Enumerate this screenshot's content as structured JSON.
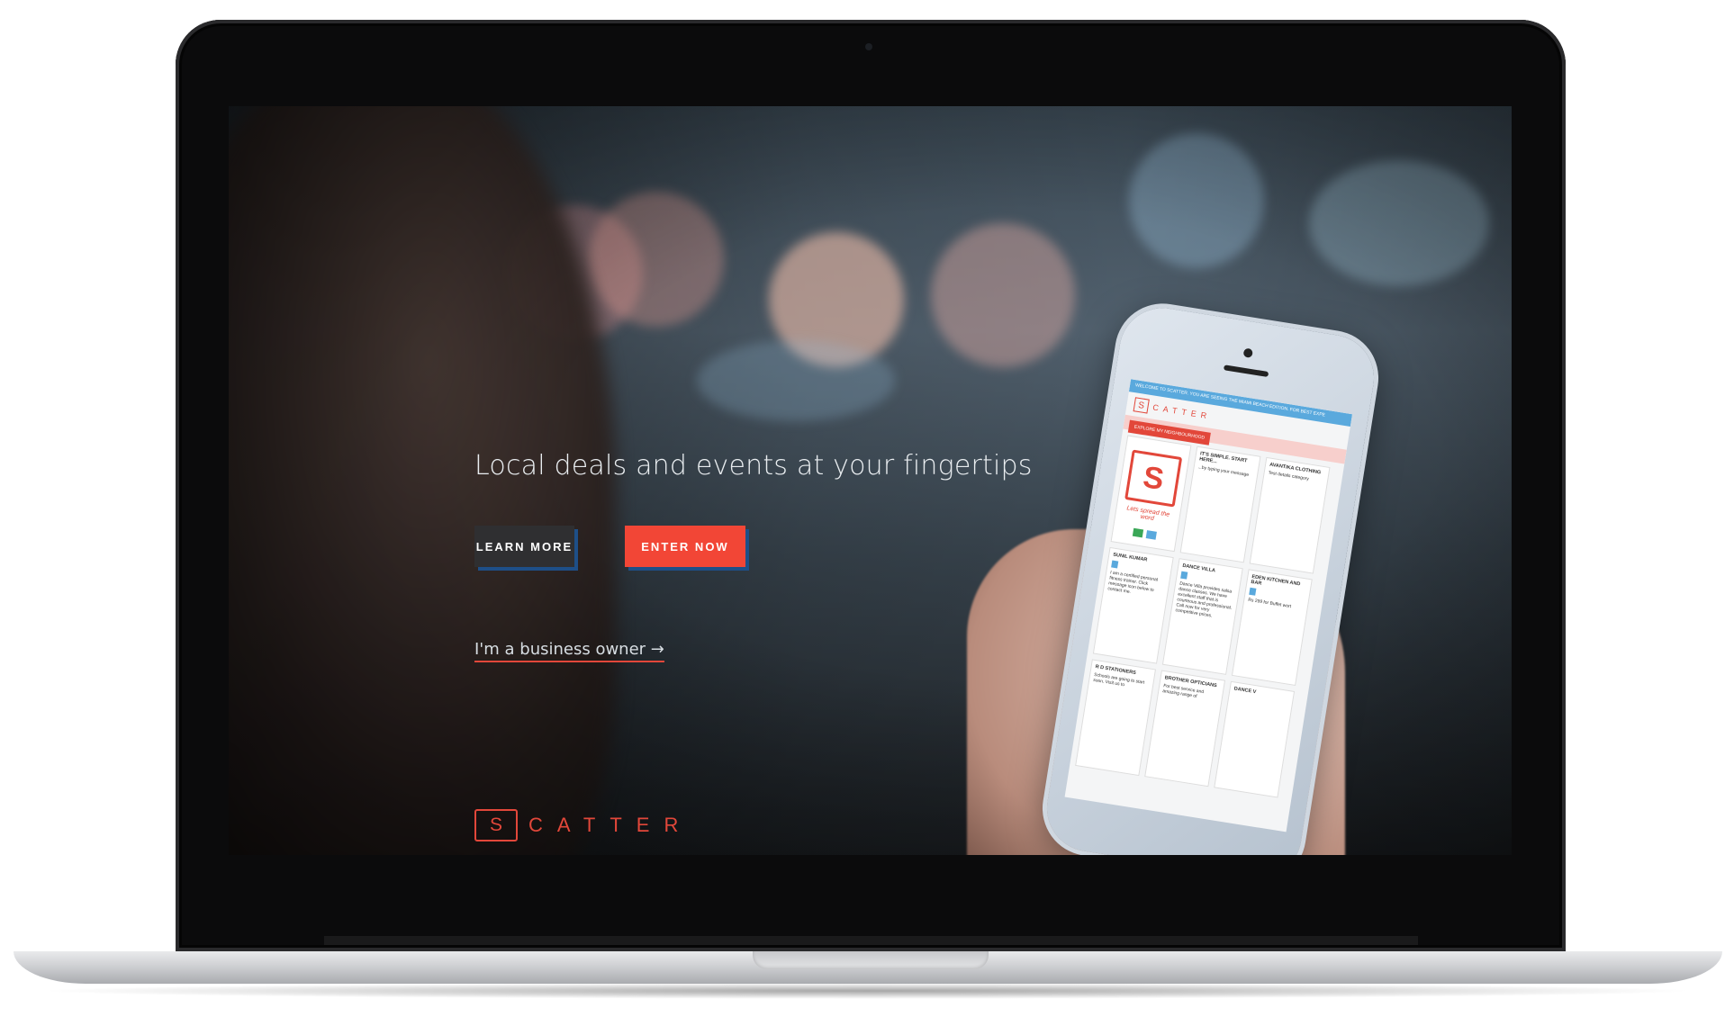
{
  "hero": {
    "title": "Local deals and events at your fingertips",
    "learn_more_label": "LEARN MORE",
    "enter_now_label": "ENTER NOW",
    "business_link": "I'm a business owner →"
  },
  "brand": {
    "logo_letter": "S",
    "logo_text": "CATTER",
    "accent_color": "#e2473a",
    "button_dark_color": "#2f2f31",
    "button_red_color": "#f24636",
    "button_shadow_color": "#1e4f88"
  },
  "phone_app": {
    "top_bar": "WELCOME TO SCATTER. YOU ARE SEEING THE MIAMI BEACH EDITION. FOR BEST EXPE",
    "logo_letter": "S",
    "logo_text": "CATTER",
    "strip_button": "EXPLORE MY NEIGHBOURHOOD",
    "tagline": "Lets spread the word",
    "cards": [
      {
        "title": "IT'S SIMPLE. START HERE...",
        "text": "...by typing your message"
      },
      {
        "title": "AVANTIKA CLOTHING",
        "text": "Test details category"
      },
      {
        "title": "SUNIL KUMAR",
        "text": "I am a certified personal fitness trainer. Click message icon below to contact me."
      },
      {
        "title": "DANCE VILLA",
        "text": "Dance Villa provides salsa dance classes. We have excellent staff that is courteous and professional. Call now for very competitive prices."
      },
      {
        "title": "EDEN KITCHEN AND BAR",
        "text": "Rs 299 for Buffet wort"
      },
      {
        "title": "R D STATIONERS",
        "text": "Schools are going to start soon. Visit us to"
      },
      {
        "title": "BROTHER OPTICIANS",
        "text": "For best service and amazing range of"
      },
      {
        "title": "DANCE V",
        "text": ""
      }
    ]
  }
}
